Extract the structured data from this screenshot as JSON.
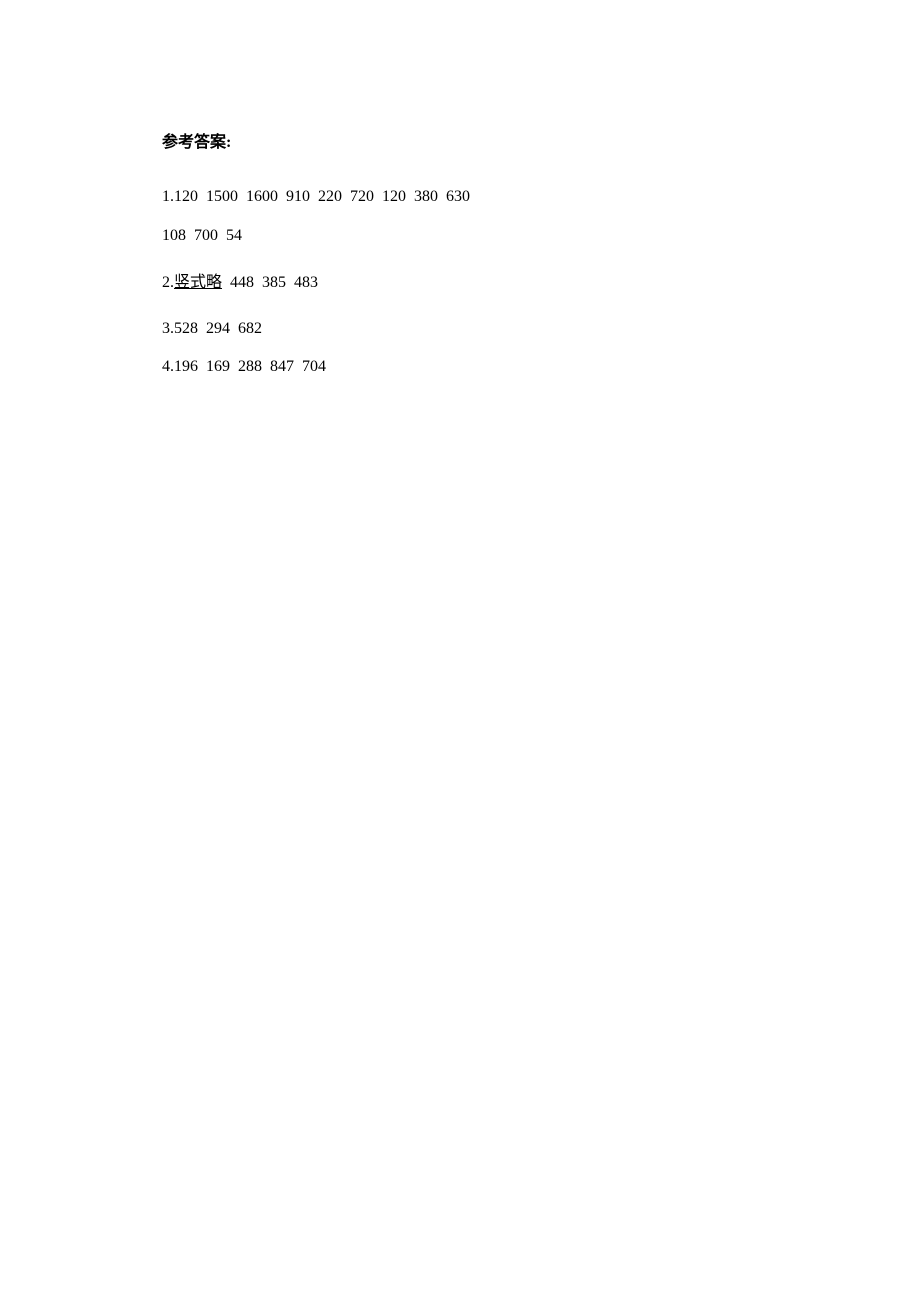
{
  "heading": "参考答案:",
  "answers": {
    "q1": {
      "line1": "1.120  1500  1600  910  220  720  120  380  630",
      "line2": "108  700  54"
    },
    "q2": {
      "prefix": "2.",
      "underlined": "竖式略",
      "rest": "  448  385  483"
    },
    "q3": "3.528  294  682",
    "q4": "4.196  169  288  847  704"
  }
}
